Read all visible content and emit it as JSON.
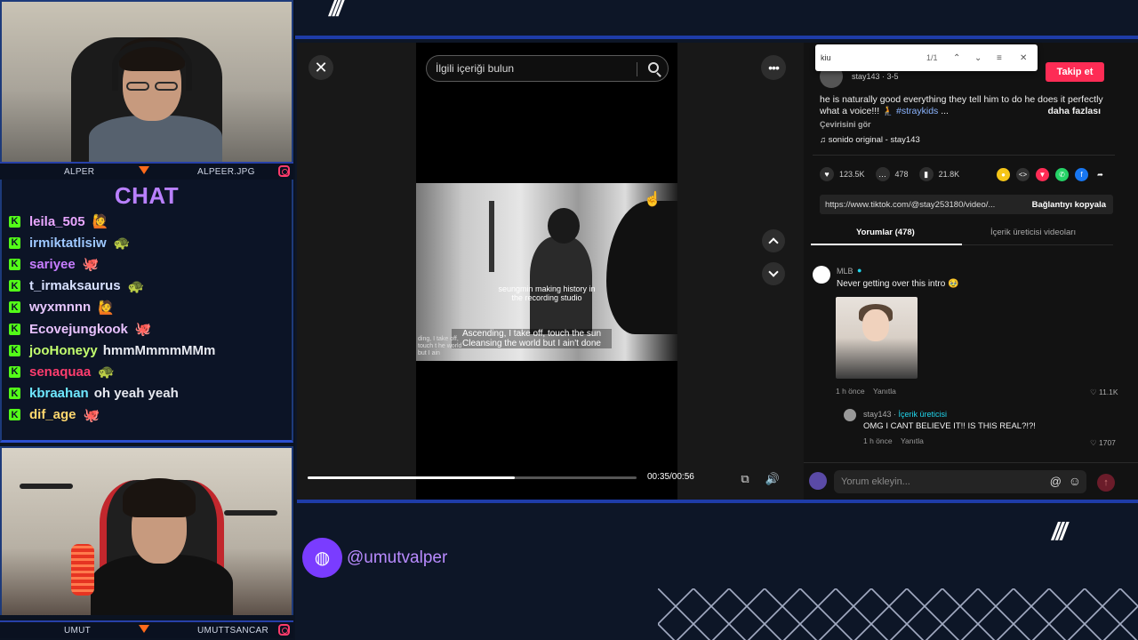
{
  "overlay": {
    "top_cam": {
      "name_left": "ALPER",
      "name_right": "ALPEER.JPG"
    },
    "bottom_cam": {
      "name_left": "UMUT",
      "name_right": "UMUTTSANCAR"
    },
    "chat_title": "CHAT",
    "chat": [
      {
        "user": "leila_505",
        "color": "#e9a6ff",
        "msg": "",
        "emote": "🙋"
      },
      {
        "user": "irmiktatlisiw",
        "color": "#9ec8ff",
        "msg": "",
        "emote": "🐢"
      },
      {
        "user": "sariyee",
        "color": "#c77dff",
        "msg": "",
        "emote": "🐙"
      },
      {
        "user": "t_irmaksaurus",
        "color": "#d7e0ff",
        "msg": "",
        "emote": "🐢"
      },
      {
        "user": "wyxmnnn",
        "color": "#e7c6ff",
        "msg": "",
        "emote": "🙋"
      },
      {
        "user": "Ecovejungkook",
        "color": "#e9c2ff",
        "msg": "",
        "emote": "🐙"
      },
      {
        "user": "jooHoneyy",
        "color": "#c3ff6e",
        "msg": "hmmMmmmMMm",
        "emote": ""
      },
      {
        "user": "senaquaa",
        "color": "#ff3d6e",
        "msg": "",
        "emote": "🐢"
      },
      {
        "user": "kbraahan",
        "color": "#6ee7ff",
        "msg": "oh yeah yeah",
        "emote": ""
      },
      {
        "user": "dif_age",
        "color": "#ffd76e",
        "msg": "",
        "emote": "🐙"
      }
    ],
    "handle": "@umutvalper",
    "icon_names": {
      "globe": "globe-icon",
      "instagram": "instagram-icon"
    }
  },
  "tiktok": {
    "search_placeholder": "İlgili içeriği bulun",
    "video": {
      "caption_overlay": "seungmin making history in the recording studio",
      "subtitle": "Ascending, I take off, touch the sun Cleansing the world but I ain't done",
      "edge_text": "ding, I take off, touch t he world but I ain",
      "time": "00:35/00:56",
      "progress": 0.63
    },
    "find_bar": {
      "query": "kiu",
      "count": "1/1"
    },
    "author": "stay143 · 3-5",
    "follow_label": "Takip et",
    "description": "he is naturally good everything they tell him to do he does it perfectly what a voice!!! 🧎",
    "hashtag": "#straykids",
    "ellipsis": "...",
    "more_label": "daha fazlası",
    "translate_label": "Çevirisini gör",
    "sound": "♫ sonido original - stay143",
    "stats": {
      "likes": "123.5K",
      "comments": "478",
      "saves": "21.8K"
    },
    "link": "https://www.tiktok.com/@stay253180/video/...",
    "copy_label": "Bağlantıyı kopyala",
    "tabs": {
      "comments": "Yorumlar (478)",
      "creator_videos": "İçerik üreticisi videoları"
    },
    "comments": [
      {
        "name": "MLB",
        "text": "Never getting over this intro 🥹",
        "time": "1 h önce",
        "reply": "Yanıtla",
        "likes": "11.1K"
      },
      {
        "name": "stay143",
        "creator_tag": "İçerik üreticisi",
        "text": "OMG I CANT BELIEVE IT!! IS THIS REAL?!?!",
        "time": "1 h önce",
        "reply": "Yanıtla",
        "likes": "1707"
      }
    ],
    "add_comment_placeholder": "Yorum ekleyin..."
  },
  "colors": {
    "accent_blue": "#1e3ca8",
    "tiktok_red": "#fe2c55",
    "kick_green": "#53fc18",
    "purple": "#b980ff"
  }
}
